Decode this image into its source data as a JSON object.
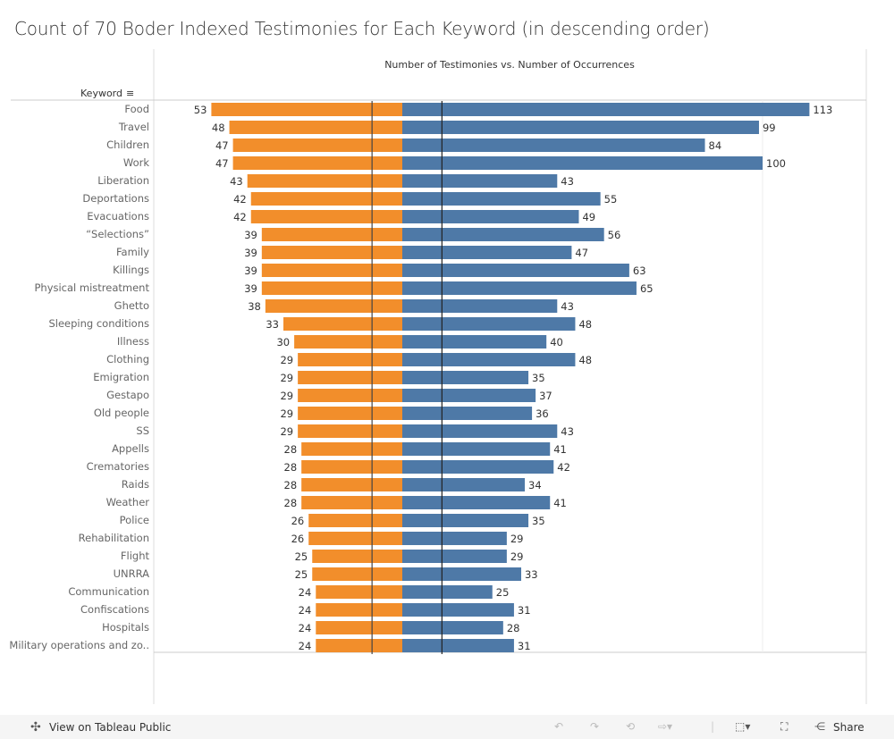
{
  "title": "Count of 70 Boder Indexed Testimonies for Each Keyword (in descending order)",
  "chart_data": {
    "type": "bar",
    "subtitle": "Number of Testimonies vs. Number of Occurrences",
    "row_header": "Keyword",
    "categories": [
      "Food",
      "Travel",
      "Children",
      "Work",
      "Liberation",
      "Deportations",
      "Evacuations",
      "“Selections”",
      "Family",
      "Killings",
      "Physical mistreatment",
      "Ghetto",
      "Sleeping conditions",
      "Illness",
      "Clothing",
      "Emigration",
      "Gestapo",
      "Old people",
      "SS",
      "Appells",
      "Crematories",
      "Raids",
      "Weather",
      "Police",
      "Rehabilitation",
      "Flight",
      "UNRRA",
      "Communication",
      "Confiscations",
      "Hospitals",
      "Military operations and zo.."
    ],
    "series": [
      {
        "values": [
          53,
          48,
          47,
          47,
          43,
          42,
          42,
          39,
          39,
          39,
          39,
          38,
          33,
          30,
          29,
          29,
          29,
          29,
          29,
          28,
          28,
          28,
          28,
          26,
          26,
          25,
          25,
          24,
          24,
          24,
          24
        ],
        "color": "#f28e2b",
        "direction": "left",
        "reference_line": 8.4
      },
      {
        "values": [
          113,
          99,
          84,
          100,
          43,
          55,
          49,
          56,
          47,
          63,
          65,
          43,
          48,
          40,
          48,
          35,
          37,
          36,
          43,
          41,
          42,
          34,
          41,
          35,
          29,
          29,
          33,
          25,
          31,
          28,
          31
        ],
        "color": "#4e79a7",
        "direction": "right",
        "reference_line": 11
      }
    ],
    "grid": "x=100 on right axis"
  },
  "toolbar": {
    "view_label": "View on Tableau Public",
    "share_label": "Share"
  }
}
